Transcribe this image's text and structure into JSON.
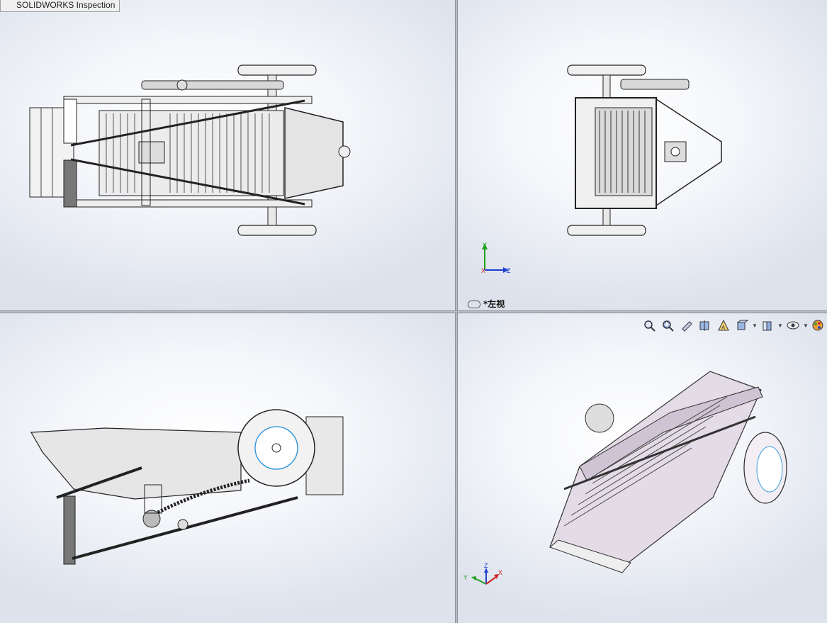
{
  "window": {
    "tab_title": "SOLIDWORKS Inspection"
  },
  "viewports": {
    "top_left": {
      "name": "top view"
    },
    "top_right": {
      "name": "left view",
      "label": "*左视"
    },
    "bottom_left": {
      "name": "front view"
    },
    "bottom_right": {
      "name": "isometric view"
    }
  },
  "triad_top_right": {
    "y": "Y",
    "x": "X",
    "z": "Z"
  },
  "triad_bottom_right": {
    "y": "Y",
    "z": "Z",
    "x": "X"
  },
  "hud_toolbar": [
    {
      "icon": "zoom-to-fit-icon"
    },
    {
      "icon": "zoom-to-area-icon"
    },
    {
      "icon": "previous-view-icon"
    },
    {
      "icon": "section-view-icon"
    },
    {
      "icon": "dynamic-annotation-views-icon"
    },
    {
      "icon": "view-orientation-icon"
    },
    {
      "icon": "display-style-icon"
    },
    {
      "icon": "hide-show-items-icon"
    },
    {
      "icon": "edit-appearance-icon"
    }
  ],
  "colors": {
    "viewport_bg_center": "#ffffff",
    "viewport_bg_edge": "#dde2ec",
    "model_fill": "#e6e6e8",
    "model_outline": "#222222",
    "iso_model_fill": "#e3dbe6",
    "triad_x": "#d02020",
    "triad_y": "#20a020",
    "triad_z": "#2040d0"
  }
}
